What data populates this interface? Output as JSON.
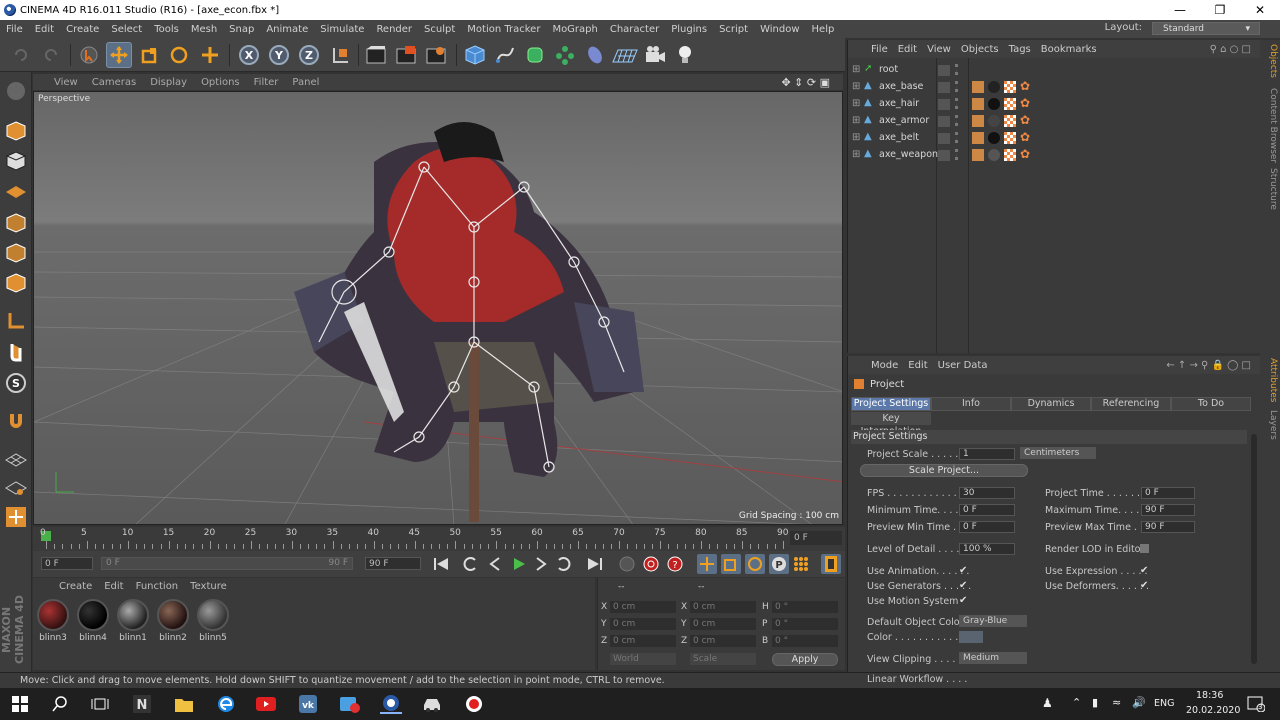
{
  "window": {
    "title": "CINEMA 4D R16.011 Studio (R16) - [axe_econ.fbx *]"
  },
  "menubar": {
    "items": [
      "File",
      "Edit",
      "Create",
      "Select",
      "Tools",
      "Mesh",
      "Snap",
      "Animate",
      "Simulate",
      "Render",
      "Sculpt",
      "Motion Tracker",
      "MoGraph",
      "Character",
      "Plugins",
      "Script",
      "Window",
      "Help"
    ],
    "layout_label": "Layout:",
    "layout_value": "Standard"
  },
  "toolbar": {
    "icons": [
      "undo-icon",
      "redo-icon",
      "select-icon",
      "move-icon",
      "scale-icon",
      "rotate-icon",
      "live-select-icon",
      "x-axis-icon",
      "y-axis-icon",
      "z-axis-icon",
      "coordinate-system-icon",
      "render-view-icon",
      "render-picture-viewer-icon",
      "render-settings-icon",
      "cube-icon",
      "pen-icon",
      "subdivision-icon",
      "cloner-icon",
      "deformer-icon",
      "floor-icon",
      "camera-icon",
      "light-icon"
    ],
    "axis_labels": [
      "X",
      "Y",
      "Z"
    ]
  },
  "viewport": {
    "menu": [
      "View",
      "Cameras",
      "Display",
      "Options",
      "Filter",
      "Panel"
    ],
    "label": "Perspective",
    "grid_spacing": "Grid Spacing : 100 cm"
  },
  "timeline": {
    "ticks": [
      "0",
      "5",
      "10",
      "15",
      "20",
      "25",
      "30",
      "35",
      "40",
      "45",
      "50",
      "55",
      "60",
      "65",
      "70",
      "75",
      "80",
      "85",
      "90"
    ],
    "current_frame": "0 F",
    "start_field": "0 F",
    "range_start": "0 F",
    "range_end": "90 F",
    "end_field": "90 F"
  },
  "materials": {
    "menu": [
      "Create",
      "Edit",
      "Function",
      "Texture"
    ],
    "items": [
      "blinn3",
      "blinn4",
      "blinn1",
      "blinn2",
      "blinn5"
    ]
  },
  "coordinates": {
    "header": [
      "--",
      "--"
    ],
    "rows": [
      {
        "l1": "X",
        "v1": "0 cm",
        "l2": "X",
        "v2": "0 cm",
        "l3": "H",
        "v3": "0 °"
      },
      {
        "l1": "Y",
        "v1": "0 cm",
        "l2": "Y",
        "v2": "0 cm",
        "l3": "P",
        "v3": "0 °"
      },
      {
        "l1": "Z",
        "v1": "0 cm",
        "l2": "Z",
        "v2": "0 cm",
        "l3": "B",
        "v3": "0 °"
      }
    ],
    "mode1": "World",
    "mode2": "Scale",
    "apply": "Apply"
  },
  "status": "Move: Click and drag to move elements. Hold down SHIFT to quantize movement / add to the selection in point mode, CTRL to remove.",
  "objects": {
    "menu": [
      "File",
      "Edit",
      "View",
      "Objects",
      "Tags",
      "Bookmarks"
    ],
    "items": [
      "root",
      "axe_base",
      "axe_hair",
      "axe_armor",
      "axe_belt",
      "axe_weapon"
    ]
  },
  "sidetabs": [
    "Objects",
    "Content Browser",
    "Structure",
    "Attributes",
    "Layers"
  ],
  "attributes": {
    "menu": [
      "Mode",
      "Edit",
      "User Data"
    ],
    "title": "Project",
    "tabs": [
      "Project Settings",
      "Info",
      "Dynamics",
      "Referencing",
      "To Do"
    ],
    "subtab": "Key Interpolation",
    "section": "Project Settings",
    "project_scale_label": "Project Scale . . . . . .",
    "project_scale": "1",
    "project_scale_unit": "Centimeters",
    "scale_project": "Scale Project...",
    "fps_label": "FPS . . . . . . . . . . . . . . .",
    "fps": "30",
    "project_time_label": "Project Time . . . . . . . .",
    "project_time": "0 F",
    "min_time_label": "Minimum Time. . . . . .",
    "min_time": "0 F",
    "max_time_label": "Maximum Time. . . . . .",
    "max_time": "90 F",
    "prev_min_label": "Preview Min Time . . .",
    "prev_min": "0 F",
    "prev_max_label": "Preview Max Time . . .",
    "prev_max": "90 F",
    "lod_label": "Level of Detail . . . . . .",
    "lod": "100 %",
    "render_lod_label": "Render LOD in Editor",
    "use_anim_label": "Use Animation. . . . . .",
    "use_expr_label": "Use Expression . . . . .",
    "use_gen_label": "Use Generators . . . . .",
    "use_def_label": "Use Deformers. . . . . .",
    "use_motion_label": "Use Motion System",
    "def_color_label": "Default Object Color",
    "def_color": "Gray-Blue",
    "color_label": "Color . . . . . . . . . . . .",
    "clipping_label": "View Clipping . . . . . .",
    "clipping": "Medium",
    "linear_label": "Linear Workflow . . . ."
  },
  "taskbar": {
    "lang": "ENG",
    "time": "18:36",
    "date": "20.02.2020",
    "notif": "3"
  }
}
